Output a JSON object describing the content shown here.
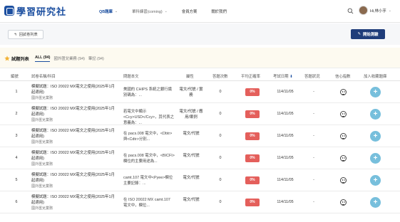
{
  "header": {
    "logo_text": "學習研究社",
    "nav": [
      {
        "label": "QB題庫",
        "active": true
      },
      {
        "label": "單科練習(coming)",
        "dim": true
      },
      {
        "label": "會員方案"
      },
      {
        "label": "關於我們"
      }
    ],
    "user_name": "Hi,林小芋"
  },
  "toolbar": {
    "back_label": "回試卷列表",
    "start_label": "開始測驗"
  },
  "list": {
    "title": "試題列表",
    "tabs": [
      {
        "label": "ALL (94)",
        "active": true
      },
      {
        "label": "國外匯兌業務 (94)"
      },
      {
        "label": "筆記 (94)"
      }
    ]
  },
  "table": {
    "headers": {
      "idx": "編號",
      "name": "試卷名稱/科目",
      "question": "問題本文",
      "attr": "屬性",
      "count": "答題次數",
      "rate": "平均正確率",
      "date": "考試日期",
      "status": "答題狀況",
      "confidence": "信心指數",
      "collect": "加入收藏題庫"
    },
    "rows": [
      {
        "idx": "1",
        "name": "模擬試題：ISO 20022 MX電文之使用(2025年1月起適用)",
        "subject": "國外匯兌業務",
        "question": "美國的 CHIPS 系統之銀行識別碼為：...",
        "attr": "電文/代號 / 實務",
        "count": "0",
        "rate": "0%",
        "date": "114/11/05",
        "status": "-"
      },
      {
        "idx": "2",
        "name": "模擬試題：ISO 20022 MX電文之使用(2025年1月起適用)",
        "subject": "國外匯兌業務",
        "question": "若電文中顯示<Ccy>USD</Ccy>，其代表之意義為：...",
        "attr": "電文/代號 / 應用/案例",
        "count": "0",
        "rate": "0%",
        "date": "114/11/05",
        "status": "-"
      },
      {
        "idx": "3",
        "name": "模擬試題：ISO 20022 MX電文之使用(2025年1月起適用)",
        "subject": "國外匯兌業務",
        "question": "在 pacs.008 電文中，<Dbtr>與<Cdtr>分別...",
        "attr": "電文/代號",
        "count": "0",
        "rate": "0%",
        "date": "114/11/05",
        "status": "-"
      },
      {
        "idx": "4",
        "name": "模擬試題：ISO 20022 MX電文之使用(2025年1月起適用)",
        "subject": "國外匯兌業務",
        "question": "在 pacs.008 電文中，<BICFI>欄位的主要用途為...",
        "attr": "電文/代號",
        "count": "0",
        "rate": "0%",
        "date": "114/11/05",
        "status": "-"
      },
      {
        "idx": "5",
        "name": "模擬試題：ISO 20022 MX電文之使用(2025年1月起適用)",
        "subject": "國外匯兌業務",
        "question": "camt.107 電文中<Pyee>欄位主要記錄：...",
        "attr": "電文/代號",
        "count": "0",
        "rate": "0%",
        "date": "114/11/05",
        "status": "-"
      },
      {
        "idx": "6",
        "name": "模擬試題：ISO 20022 MX電文之使用(2025年1月起適用)",
        "subject": "國外匯兌業務",
        "question": "在 ISO 20022 MX camt.107 電文中，欄位...",
        "attr": "電文/代號",
        "count": "0",
        "rate": "0%",
        "date": "114/11/05",
        "status": "-"
      }
    ]
  },
  "colors": {
    "brand": "#1c4fa0",
    "primary_button": "#1f3d7a",
    "rate_badge": "#e45f5b",
    "add_button": "#77bfdc"
  },
  "icons": [
    "logo-icon",
    "chevron-down-icon",
    "search-icon",
    "avatar",
    "back-arrow-icon",
    "edit-icon",
    "star-icon",
    "sort-down-icon",
    "neutral-face-icon",
    "plus-icon"
  ]
}
